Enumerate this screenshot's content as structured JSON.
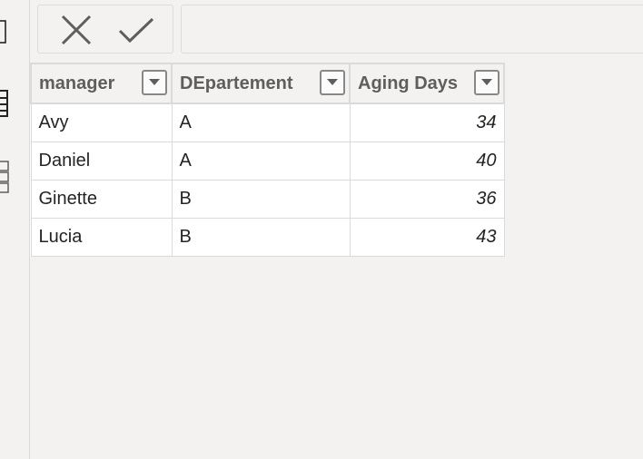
{
  "formula_bar": {
    "cancel_icon": "x-icon",
    "commit_icon": "check-icon",
    "expression": ""
  },
  "left_rail": {
    "icons": [
      "report-view-icon",
      "data-view-icon",
      "model-view-icon"
    ]
  },
  "table": {
    "columns": [
      {
        "label": "manager"
      },
      {
        "label": "DEpartement"
      },
      {
        "label": "Aging Days"
      }
    ],
    "rows": [
      {
        "manager": "Avy",
        "departement": "A",
        "aging_days": "34"
      },
      {
        "manager": "Daniel",
        "departement": "A",
        "aging_days": "40"
      },
      {
        "manager": "Ginette",
        "departement": "B",
        "aging_days": "36"
      },
      {
        "manager": "Lucia",
        "departement": "B",
        "aging_days": "43"
      }
    ]
  },
  "colors": {
    "background": "#f3f2f1",
    "border": "#dadada",
    "text": "#252423",
    "header_text": "#605e5c"
  }
}
